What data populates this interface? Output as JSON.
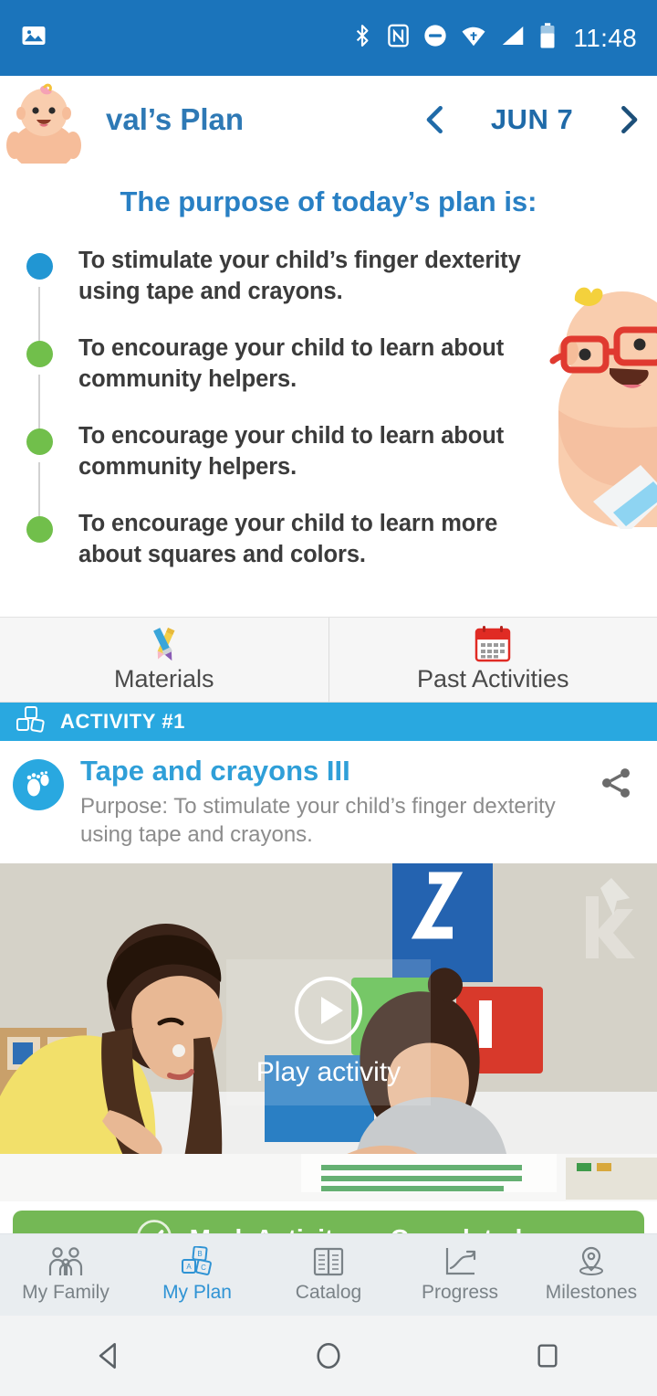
{
  "statusbar": {
    "time": "11:48",
    "icons": [
      "photo-icon",
      "bluetooth-icon",
      "nfc-icon",
      "do-not-disturb-icon",
      "wifi-icon",
      "cell-signal-icon",
      "battery-icon"
    ]
  },
  "header": {
    "avatar": "baby-avatar",
    "title": "val’s Plan",
    "prev_icon": "chevron-left-icon",
    "date": "JUN 7",
    "next_icon": "chevron-right-icon",
    "title_color": "#2e79b5"
  },
  "purpose": {
    "heading": "The purpose of today’s plan is:",
    "heading_color": "#2980c4",
    "goals": [
      {
        "text": "To stimulate your child’s finger dexterity using tape and crayons.",
        "dot_color": "#2196d3",
        "state": "current"
      },
      {
        "text": "To encourage your child to learn about community helpers.",
        "dot_color": "#71bf4b",
        "state": "done"
      },
      {
        "text": "To encourage your child to learn about community helpers.",
        "dot_color": "#71bf4b",
        "state": "done"
      },
      {
        "text": "To encourage your child to learn more about squares and colors.",
        "dot_color": "#71bf4b",
        "state": "done"
      }
    ]
  },
  "tiles": [
    {
      "label": "Materials",
      "icon": "pencil-paintbrush-icon"
    },
    {
      "label": "Past Activities",
      "icon": "calendar-icon"
    }
  ],
  "activity_bar": {
    "label": "ACTIVITY #1",
    "icon": "blocks-icon",
    "color": "#29a8e0"
  },
  "activity": {
    "icon": "footprints-icon",
    "title": "Tape and crayons III",
    "title_color": "#2f9fd8",
    "purpose": "Purpose: To stimulate your child’s finger dexterity using tape and crayons.",
    "share_icon": "share-icon"
  },
  "video": {
    "play_icon": "play-icon",
    "play_label": "Play activity",
    "watermark": "k-logo-watermark"
  },
  "mark_button": {
    "label": "Mark Activity as Completed",
    "icon": "check-circle-icon",
    "color": "#74b855"
  },
  "bottom_nav": {
    "active_color": "#2f93d4",
    "items": [
      {
        "label": "My Family",
        "icon": "family-icon",
        "active": false
      },
      {
        "label": "My Plan",
        "icon": "abc-blocks-icon",
        "active": true
      },
      {
        "label": "Catalog",
        "icon": "book-icon",
        "active": false
      },
      {
        "label": "Progress",
        "icon": "chart-arrow-icon",
        "active": false
      },
      {
        "label": "Milestones",
        "icon": "map-pin-icon",
        "active": false
      }
    ]
  },
  "android_nav": {
    "back": "back-triangle-icon",
    "home": "home-circle-icon",
    "recents": "recents-square-icon"
  }
}
